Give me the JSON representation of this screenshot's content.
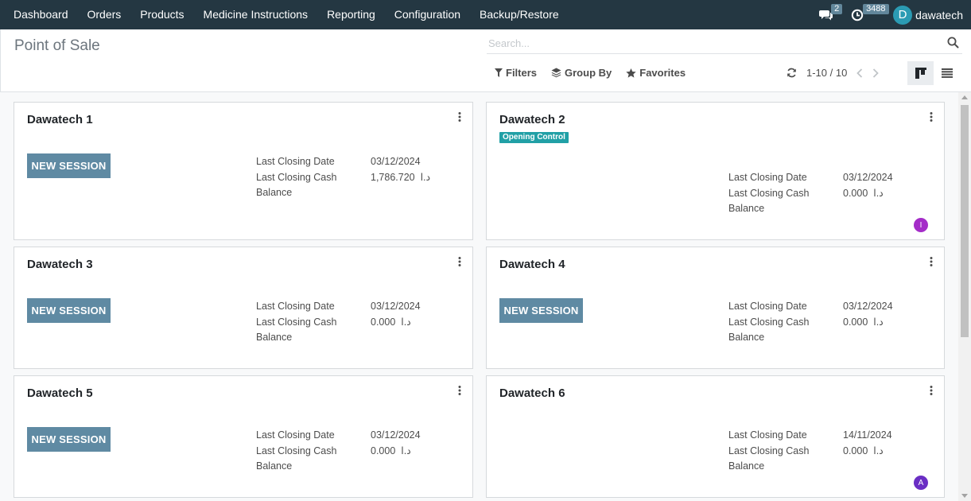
{
  "navbar": {
    "items": [
      {
        "label": "Dashboard"
      },
      {
        "label": "Orders"
      },
      {
        "label": "Products"
      },
      {
        "label": "Medicine Instructions"
      },
      {
        "label": "Reporting"
      },
      {
        "label": "Configuration"
      },
      {
        "label": "Backup/Restore"
      }
    ],
    "messages_count": "2",
    "activities_count": "3488",
    "user_initial": "D",
    "user_name": "dawatech"
  },
  "control_panel": {
    "title": "Point of Sale",
    "search_placeholder": "Search...",
    "filters_label": "Filters",
    "group_by_label": "Group By",
    "favorites_label": "Favorites",
    "pager": "1-10 / 10"
  },
  "labels": {
    "last_closing_date": "Last Closing Date",
    "last_closing_cash_1": "Last Closing Cash",
    "last_closing_cash_2": "Balance",
    "new_session": "NEW SESSION",
    "opening_control": "Opening Control"
  },
  "cards": [
    {
      "name": "Dawatech 1",
      "date": "03/12/2024",
      "cash": "1,786.720",
      "currency": "د.ا",
      "has_button": true
    },
    {
      "name": "Dawatech 2",
      "date": "03/12/2024",
      "cash": "0.000",
      "currency": "د.ا",
      "has_button": false,
      "tag": "Opening Control",
      "avatar": "I",
      "avatar_color": "#a42cc8"
    },
    {
      "name": "Dawatech 3",
      "date": "03/12/2024",
      "cash": "0.000",
      "currency": "د.ا",
      "has_button": true
    },
    {
      "name": "Dawatech 4",
      "date": "03/12/2024",
      "cash": "0.000",
      "currency": "د.ا",
      "has_button": true
    },
    {
      "name": "Dawatech 5",
      "date": "03/12/2024",
      "cash": "0.000",
      "currency": "د.ا",
      "has_button": true
    },
    {
      "name": "Dawatech 6",
      "date": "14/11/2024",
      "cash": "0.000",
      "currency": "د.ا",
      "has_button": false,
      "avatar": "A",
      "avatar_color": "#6a2ec4"
    }
  ],
  "colors": {
    "navbar_bg": "#243742",
    "button_bg": "#5f8aa3",
    "tag_bg": "#21a0a6"
  }
}
